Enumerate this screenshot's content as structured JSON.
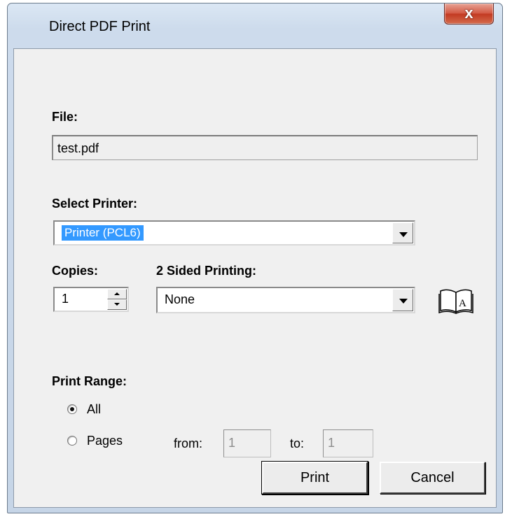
{
  "window": {
    "title": "Direct PDF Print",
    "close_label": "x"
  },
  "file": {
    "label": "File:",
    "value": "test.pdf"
  },
  "printer": {
    "label": "Select Printer:",
    "selected": "Printer (PCL6)"
  },
  "copies": {
    "label": "Copies:",
    "value": "1"
  },
  "duplex": {
    "label": "2 Sided Printing:",
    "selected": "None",
    "icon": "book-icon"
  },
  "range": {
    "label": "Print Range:",
    "all_label": "All",
    "pages_label": "Pages",
    "selected": "All",
    "from_label": "from:",
    "from_value": "1",
    "to_label": "to:",
    "to_value": "1"
  },
  "buttons": {
    "print": "Print",
    "cancel": "Cancel"
  }
}
